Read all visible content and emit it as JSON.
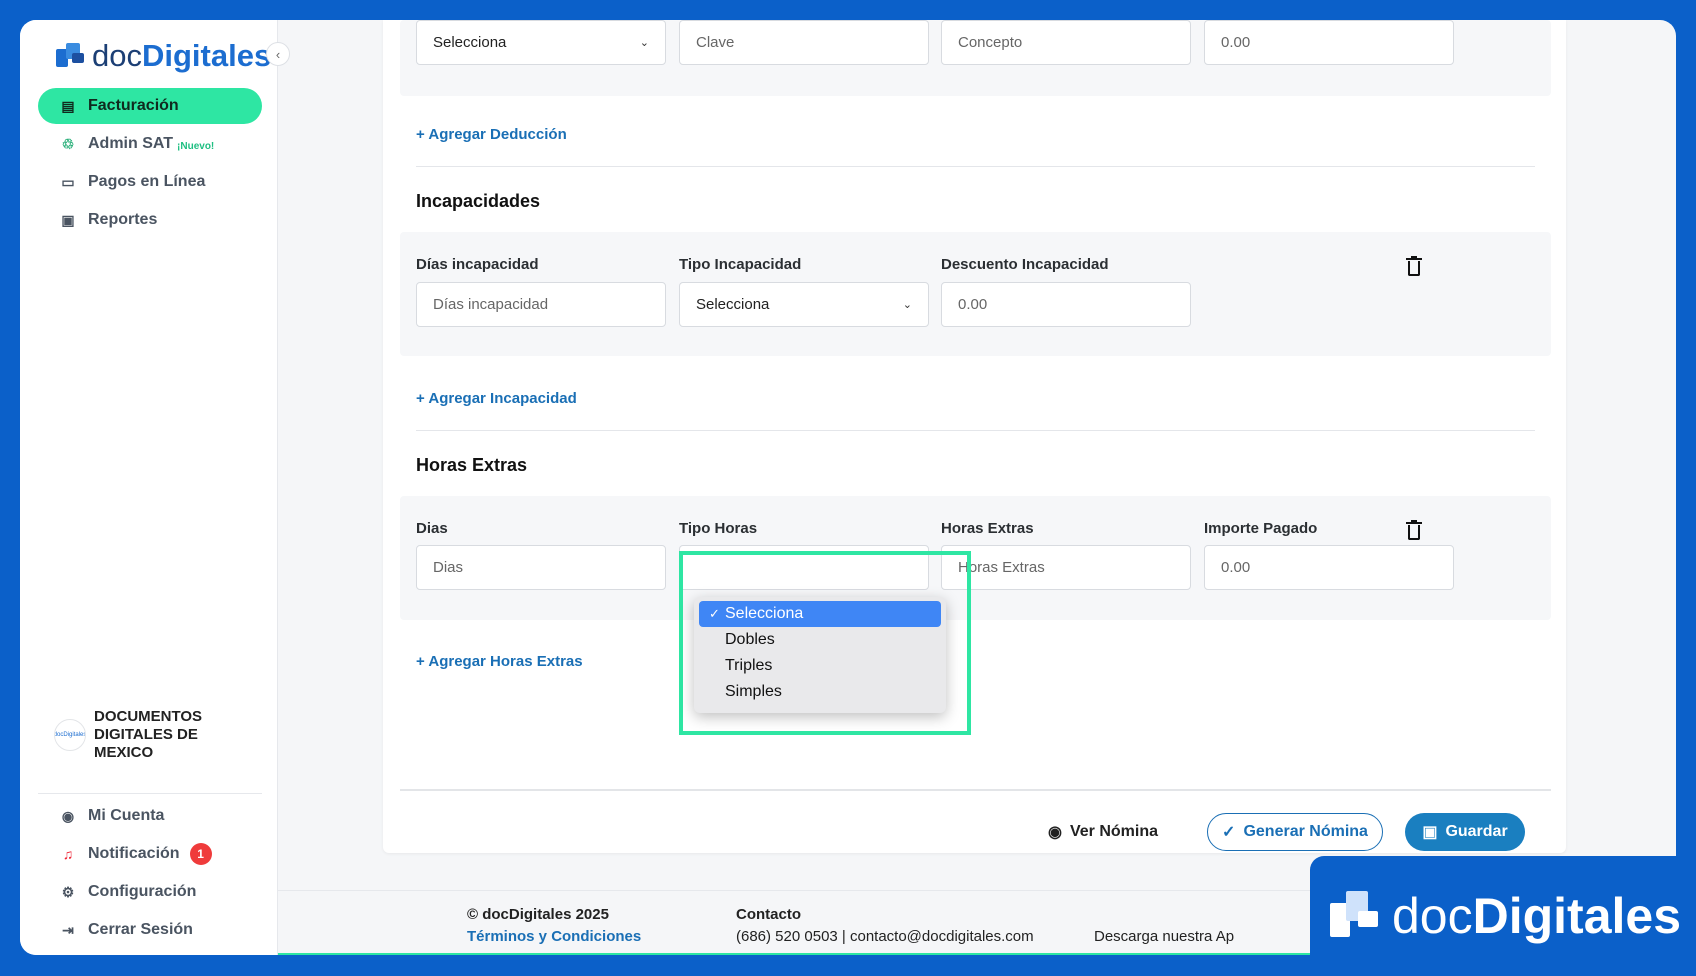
{
  "brand": {
    "name_light": "doc",
    "name_bold": "Digitales"
  },
  "sidebar": {
    "items": [
      {
        "label": "Facturación",
        "icon": "receipt-icon"
      },
      {
        "label": "Admin SAT",
        "icon": "admin-sat-icon",
        "tag": "¡Nuevo!"
      },
      {
        "label": "Pagos en Línea",
        "icon": "card-icon"
      },
      {
        "label": "Reportes",
        "icon": "folder-icon"
      }
    ],
    "company": "DOCUMENTOS DIGITALES DE MEXICO",
    "company_avatar": "docDigitales",
    "bottom": [
      {
        "label": "Mi Cuenta",
        "icon": "user-circle-icon"
      },
      {
        "label": "Notificación",
        "icon": "bell-icon",
        "badge": "1"
      },
      {
        "label": "Configuración",
        "icon": "gear-icon"
      },
      {
        "label": "Cerrar Sesión",
        "icon": "logout-icon"
      }
    ]
  },
  "deducciones": {
    "row": {
      "tipo": "Selecciona",
      "clave_ph": "Clave",
      "concepto_ph": "Concepto",
      "importe": "0.00"
    },
    "add_link": "+ Agregar Deducción"
  },
  "incapacidades": {
    "title": "Incapacidades",
    "labels": {
      "dias": "Días incapacidad",
      "tipo": "Tipo Incapacidad",
      "descuento": "Descuento Incapacidad"
    },
    "dias_ph": "Días incapacidad",
    "tipo": "Selecciona",
    "descuento": "0.00",
    "add_link": "+ Agregar Incapacidad"
  },
  "horas_extras": {
    "title": "Horas Extras",
    "labels": {
      "dias": "Dias",
      "tipo": "Tipo Horas",
      "horas": "Horas Extras",
      "importe": "Importe Pagado"
    },
    "dias_ph": "Dias",
    "horas_ph": "Horas Extras",
    "importe": "0.00",
    "options": [
      "Selecciona",
      "Dobles",
      "Triples",
      "Simples"
    ],
    "selected": "Selecciona",
    "add_link": "+ Agregar Horas Extras"
  },
  "actions": {
    "ver": "Ver Nómina",
    "generar": "Generar Nómina",
    "guardar": "Guardar"
  },
  "footer": {
    "copyright": "© docDigitales 2025",
    "terms": "Términos y Condiciones",
    "contact_title": "Contacto",
    "contact": "(686) 520 0503 | contacto@docdigitales.com",
    "download": "Descarga nuestra Ap"
  },
  "colors": {
    "accent": "#2ee6a3",
    "brand_blue": "#0b60c9",
    "link": "#1a6fb5"
  }
}
